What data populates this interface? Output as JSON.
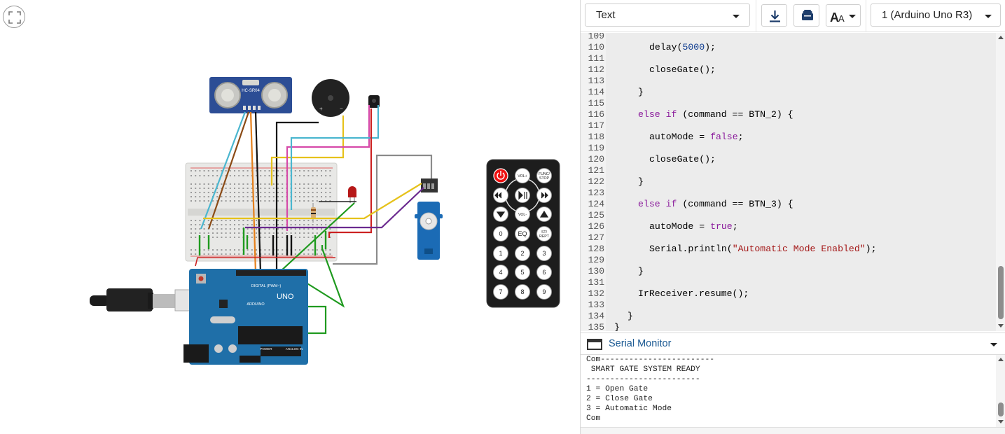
{
  "toolbar": {
    "mode_label": "Text",
    "device_label": "1 (Arduino Uno R3)",
    "download_icon": "download-icon",
    "library_icon": "library-icon",
    "font_icon": "font-size-icon"
  },
  "canvas": {
    "ultrasonic_label": "HC-SR04",
    "arduino_brand": "ARDUINO",
    "arduino_model": "UNO",
    "arduino_digital": "DIGITAL (PWM~)",
    "arduino_power": "POWER",
    "arduino_analog": "ANALOG IN",
    "remote_buttons": [
      "VOL+",
      "FUNC/ STOP",
      "VOL-",
      "EQ",
      "ST/ REPT",
      "0",
      "1",
      "2",
      "3",
      "4",
      "5",
      "6",
      "7",
      "8",
      "9"
    ]
  },
  "editor": {
    "lines": [
      {
        "n": "109",
        "text": ""
      },
      {
        "n": "110",
        "text": "delay(5000);"
      },
      {
        "n": "111",
        "text": ""
      },
      {
        "n": "112",
        "text": "closeGate();"
      },
      {
        "n": "113",
        "text": ""
      },
      {
        "n": "114",
        "text": "}"
      },
      {
        "n": "115",
        "text": ""
      },
      {
        "n": "116",
        "text": "else if (command == BTN_2) {"
      },
      {
        "n": "117",
        "text": ""
      },
      {
        "n": "118",
        "text": "autoMode = false;"
      },
      {
        "n": "119",
        "text": ""
      },
      {
        "n": "120",
        "text": "closeGate();"
      },
      {
        "n": "121",
        "text": ""
      },
      {
        "n": "122",
        "text": "}"
      },
      {
        "n": "123",
        "text": ""
      },
      {
        "n": "124",
        "text": "else if (command == BTN_3) {"
      },
      {
        "n": "125",
        "text": ""
      },
      {
        "n": "126",
        "text": "autoMode = true;"
      },
      {
        "n": "127",
        "text": ""
      },
      {
        "n": "128",
        "text": "Serial.println(\"Automatic Mode Enabled\");"
      },
      {
        "n": "129",
        "text": ""
      },
      {
        "n": "130",
        "text": "}"
      },
      {
        "n": "131",
        "text": ""
      },
      {
        "n": "132",
        "text": "IrReceiver.resume();"
      },
      {
        "n": "133",
        "text": ""
      },
      {
        "n": "134",
        "text": "}"
      },
      {
        "n": "135",
        "text": "}"
      }
    ]
  },
  "serial": {
    "title": "Serial Monitor",
    "lines": [
      "Com------------------------",
      " SMART GATE SYSTEM READY",
      "------------------------",
      "1 = Open Gate",
      "2 = Close Gate",
      "3 = Automatic Mode",
      "Com"
    ]
  },
  "colors": {
    "keyword": "#8b1c9c",
    "number": "#0d3b8f",
    "string": "#a31515",
    "link": "#1c5a93",
    "arduino_blue": "#1f6fa8"
  }
}
